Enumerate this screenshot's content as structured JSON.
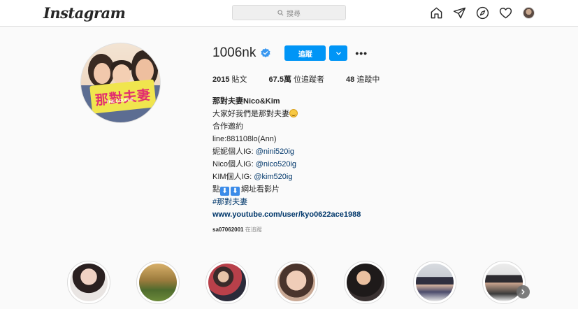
{
  "app": {
    "logo": "Instagram"
  },
  "search": {
    "placeholder": "搜尋",
    "icon": "search-icon"
  },
  "nav_icons": [
    "home-icon",
    "send-icon",
    "explore-icon",
    "heart-icon",
    "avatar"
  ],
  "profile": {
    "username": "1006nk",
    "verified": true,
    "follow_label": "追蹤",
    "more_label": "•••",
    "stats": {
      "posts_count": "2015",
      "posts_label": "貼文",
      "followers_count": "67.5萬",
      "followers_label": "位追蹤者",
      "following_count": "48",
      "following_label": "追蹤中"
    },
    "picture_text": "那對夫妻",
    "picture_subtext": "THE COUPLE"
  },
  "bio": {
    "name": "那對夫妻Nico&Kim",
    "line1": "大家好我們是那對夫妻",
    "line2": "合作邀約",
    "line3": "line:881108lo(Ann)",
    "line4_prefix": "妮妮個人IG: ",
    "line4_link": "@nini520ig",
    "line5_prefix": "Nico個人IG: ",
    "line5_link": "@nico520ig",
    "line6_prefix": "KIM個人IG: ",
    "line6_link": "@kim520ig",
    "line7_prefix": "點",
    "line7_suffix": "網址看影片",
    "down_emoji": "⬇",
    "hashtag": "#那對夫妻",
    "website": "www.youtube.com/user/kyo0622ace1988"
  },
  "followed_by": {
    "user": "sa07062001",
    "suffix": " 在追蹤"
  },
  "highlights_count": 7,
  "colors": {
    "accent": "#0095f6",
    "link": "#00376b",
    "background": "#fafafa"
  }
}
